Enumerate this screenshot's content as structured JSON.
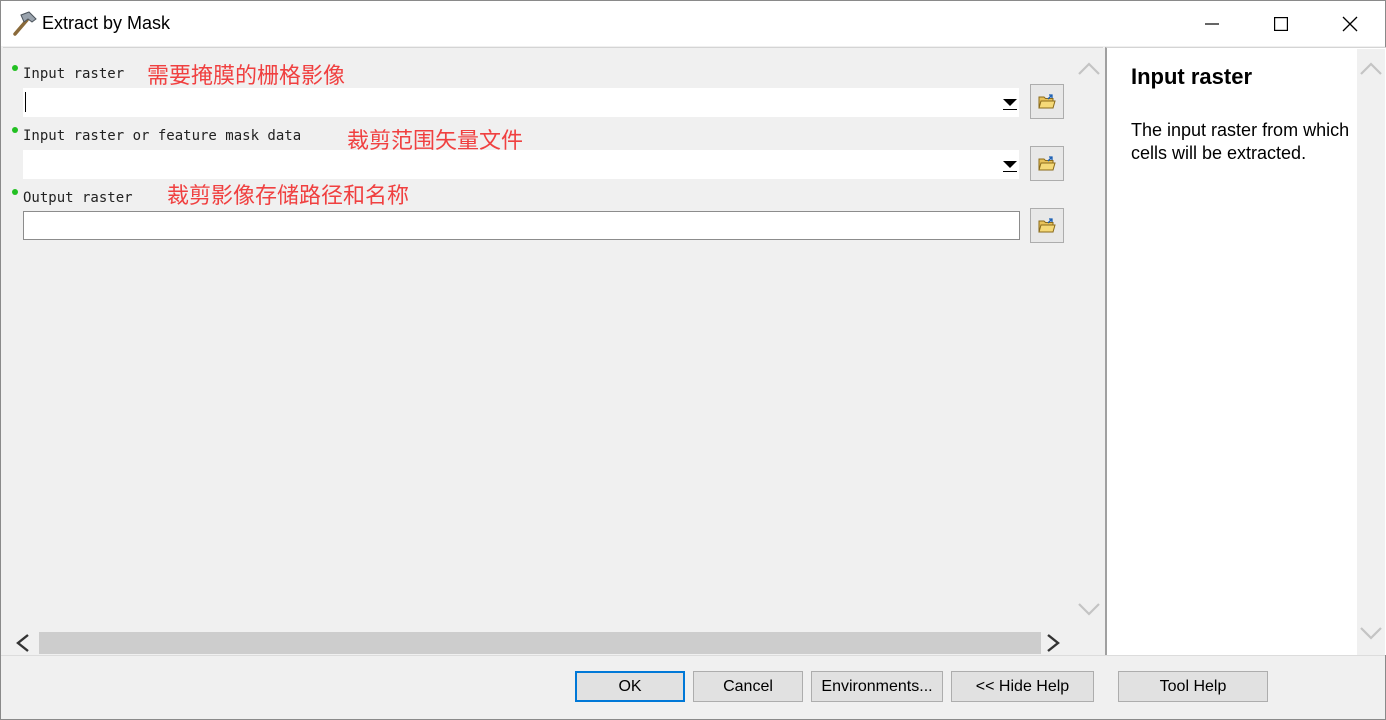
{
  "window": {
    "title": "Extract by Mask",
    "icon": "hammer-icon"
  },
  "params": [
    {
      "label": "Input raster",
      "annotation": "需要掩膜的栅格影像",
      "type": "combo",
      "value": ""
    },
    {
      "label": "Input raster or feature mask data",
      "annotation": "裁剪范围矢量文件",
      "type": "combo",
      "value": ""
    },
    {
      "label": "Output raster",
      "annotation": "裁剪影像存储路径和名称",
      "type": "text",
      "value": ""
    }
  ],
  "help": {
    "title": "Input raster",
    "body": "The input raster from which cells will be extracted."
  },
  "buttons": {
    "ok": "OK",
    "cancel": "Cancel",
    "environments": "Environments...",
    "hide_help": "<< Hide Help",
    "tool_help": "Tool Help"
  },
  "colors": {
    "annotation": "#f04040",
    "required_dot": "#22c022",
    "ok_border": "#0078d7"
  }
}
